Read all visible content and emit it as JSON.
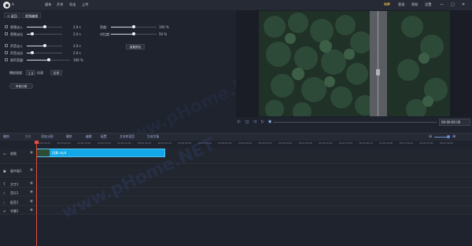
{
  "app": {
    "logo_text": "A",
    "menu": [
      "媒体",
      "开关",
      "导出",
      "上传"
    ],
    "vip_badge": "VIP",
    "top_right": [
      "登录",
      "帮助",
      "设置"
    ],
    "window_controls": [
      "—",
      "▢",
      "✕"
    ]
  },
  "editor": {
    "back_button": "< 返回",
    "tab_label": "视频编辑",
    "fade_in": {
      "label": "视频淡入",
      "value": "2.0 s",
      "fraction": 0.5
    },
    "fade_out": {
      "label": "视频淡出",
      "value": "2.0 s",
      "fraction": 0.15
    },
    "brightness": {
      "label": "亮度:",
      "value": "100 %",
      "fraction": 0.5
    },
    "contrast": {
      "label": "对比度:",
      "value": "50 %",
      "fraction": 0.5
    },
    "reset_button": "重置颜色",
    "audio_fade_in": {
      "label": "声音淡入",
      "value": "2.0 s",
      "fraction": 0.5
    },
    "audio_fade_out": {
      "label": "声音淡出",
      "value": "2.0 s",
      "fraction": 0.15
    },
    "volume": {
      "label": "原声音量:",
      "value": "100 %",
      "fraction": 0.5
    },
    "speed_label": "播放速度:",
    "speed_value": "1.0",
    "speed_unit": "倍速",
    "apply_button": "应用",
    "separate_audio_button": "声音分离"
  },
  "player": {
    "controls": [
      "▷",
      "◻",
      "◁",
      "▷",
      "◉"
    ],
    "time": "00:00:00.00"
  },
  "toolbar": {
    "items": [
      "撤销",
      "重做",
      "添加",
      "分割",
      "删除",
      "编辑",
      "配置",
      "文本转语音",
      "生成字幕"
    ],
    "zoom_minus": "⊖",
    "zoom_plus": "⊕"
  },
  "ruler": {
    "ticks": [
      "00:00:00.00",
      "00:00:05.00",
      "00:00:10.00",
      "00:00:15.00",
      "00:00:20.00",
      "00:00:25.00",
      "00:00:30.00",
      "00:00:35.00",
      "00:00:40.00",
      "00:00:45.00",
      "00:00:50.00",
      "00:00:55.00",
      "00:01:00.00",
      "00:01:05.00",
      "00:01:10.00",
      "00:01:15.00",
      "00:01:20.00",
      "00:01:25.00",
      "00:01:30.00",
      "00:01:35.00",
      "00:01:40.00"
    ]
  },
  "tracks": [
    {
      "name": "视频",
      "icon": "film-icon"
    },
    {
      "name": "画中画1",
      "icon": "pip-icon"
    },
    {
      "name": "文字1",
      "icon": "text-icon"
    },
    {
      "name": "音乐1",
      "icon": "music-icon"
    },
    {
      "name": "配音1",
      "icon": "mic-icon"
    },
    {
      "name": "字幕1",
      "icon": "subtitle-icon"
    }
  ],
  "clip": {
    "label": "风景.mp4"
  },
  "watermark": "www.pHome.NET",
  "colors": {
    "accent": "#12a7e6",
    "playhead": "#e74c3c",
    "background": "#1f232d"
  }
}
